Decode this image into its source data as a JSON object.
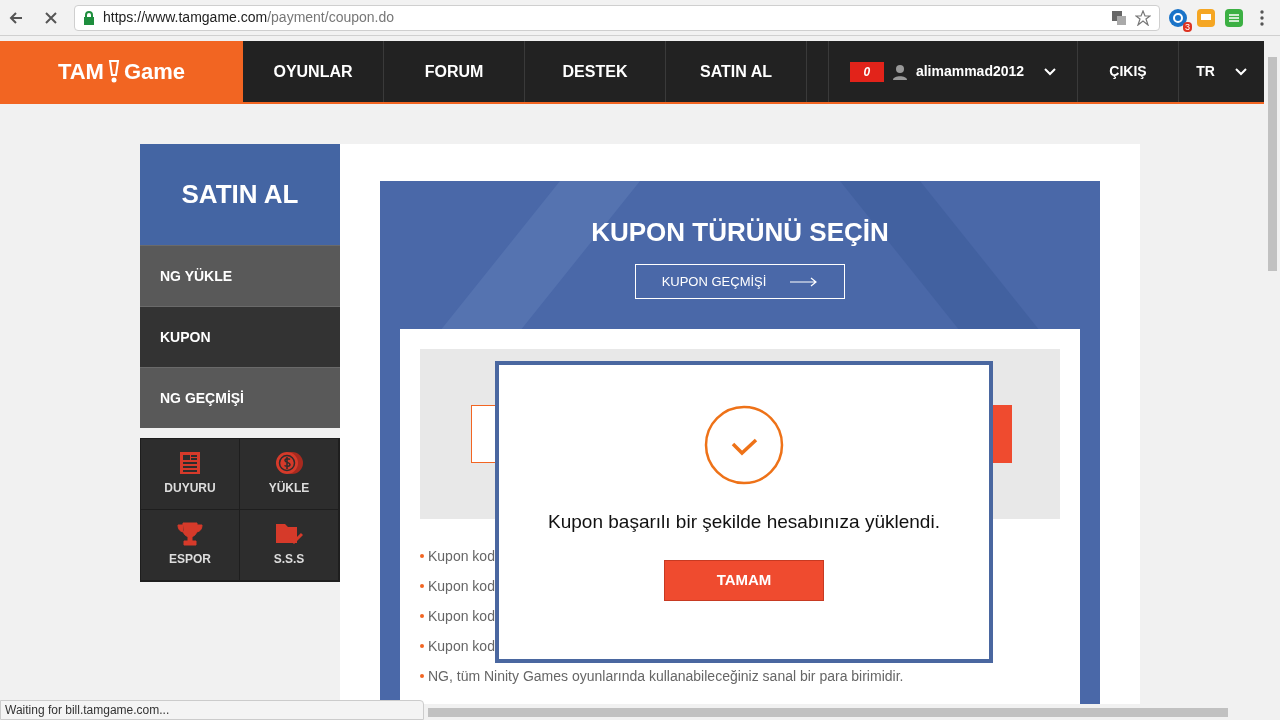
{
  "browser": {
    "url_host": "https://www.tamgame.com",
    "url_path": "/payment/coupon.do",
    "extension_badge": "3",
    "status": "Waiting for bill.tamgame.com..."
  },
  "nav": {
    "logo_left": "TAM",
    "logo_right": "Game",
    "items": [
      {
        "label": "OYUNLAR"
      },
      {
        "label": "FORUM"
      },
      {
        "label": "DESTEK"
      },
      {
        "label": "SATIN AL"
      }
    ],
    "notif_count": "0",
    "username": "alimammad2012",
    "logout": "ÇIKIŞ",
    "language": "TR"
  },
  "sidebar": {
    "title": "SATIN AL",
    "items": [
      {
        "label": "NG YÜKLE",
        "selected": false
      },
      {
        "label": "KUPON",
        "selected": true
      },
      {
        "label": "NG GEÇMİŞİ",
        "selected": false
      }
    ],
    "tiles": [
      {
        "label": "DUYURU",
        "kind": "news"
      },
      {
        "label": "YÜKLE",
        "kind": "coins"
      },
      {
        "label": "ESPOR",
        "kind": "trophy"
      },
      {
        "label": "S.S.S",
        "kind": "folder"
      }
    ]
  },
  "main": {
    "title": "KUPON TÜRÜNÜ SEÇİN",
    "history_button": "KUPON GEÇMİŞİ",
    "bullets": [
      "Kupon kod",
      "Kupon kod",
      "Kupon kod",
      "Kupon kod",
      "NG, tüm Ninity Games oyunlarında kullanabileceğiniz sanal bir para birimidir."
    ]
  },
  "dialog": {
    "message": "Kupon başarılı bir şekilde hesabınıza yüklendi.",
    "button": "TAMAM"
  }
}
